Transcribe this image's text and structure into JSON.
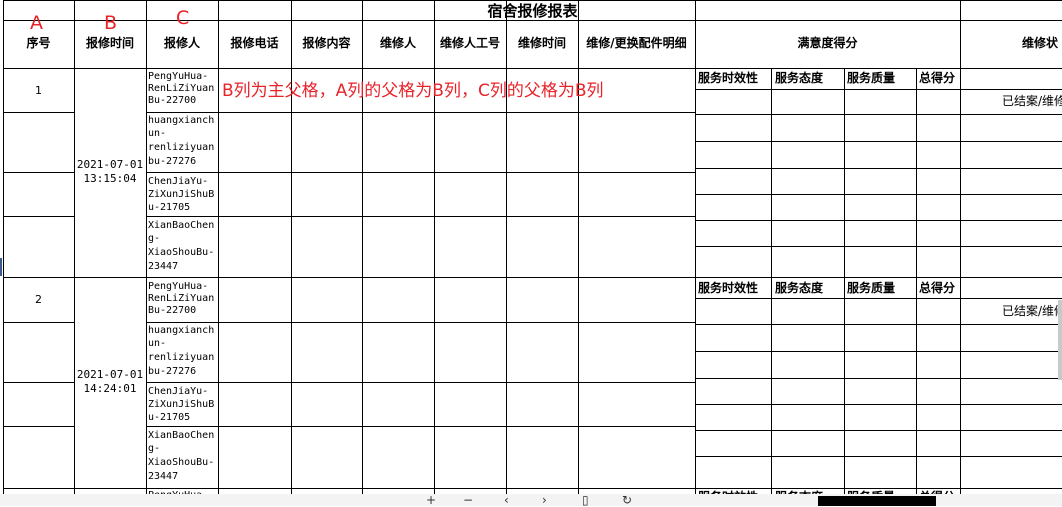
{
  "title": "宿舍报修报表",
  "column_letters": {
    "a": "A",
    "b": "B",
    "c": "C"
  },
  "headers": {
    "seq": "序号",
    "report_time": "报修时间",
    "reporter": "报修人",
    "phone": "报修电话",
    "content": "报修内容",
    "repairer": "维修人",
    "repairer_id": "维修人工号",
    "repair_time": "维修时间",
    "parts": "维修/更换配件明细",
    "satisfaction": "满意度得分",
    "status": "维修状"
  },
  "sub_headers": {
    "timeliness": "服务时效性",
    "attitude": "服务态度",
    "quality": "服务质量",
    "total": "总得分"
  },
  "annotation": "B列为主父格，A列的父格为B列，C列的父格为B列",
  "status_value": "已结案/维修",
  "groups": [
    {
      "seq": "1",
      "time_date": "2021-07-01",
      "time_clock": "13:15:04",
      "reporters": [
        {
          "l1": "PengYuHua-",
          "l2": "RenLiZiYuan",
          "l3": "Bu-22700",
          "l4": ""
        },
        {
          "l1": "huangxianch",
          "l2": "un-",
          "l3": "renliziyuan",
          "l4": "bu-27276"
        },
        {
          "l1": "ChenJiaYu-",
          "l2": "ZiXunJiShuB",
          "l3": "u-21705",
          "l4": ""
        },
        {
          "l1": "XianBaoChen",
          "l2": "g-",
          "l3": "XiaoShouBu-",
          "l4": "23447"
        }
      ]
    },
    {
      "seq": "2",
      "time_date": "2021-07-01",
      "time_clock": "14:24:01",
      "reporters": [
        {
          "l1": "PengYuHua-",
          "l2": "RenLiZiYuan",
          "l3": "Bu-22700",
          "l4": ""
        },
        {
          "l1": "huangxianch",
          "l2": "un-",
          "l3": "renliziyuan",
          "l4": "bu-27276"
        },
        {
          "l1": "ChenJiaYu-",
          "l2": "ZiXunJiShuB",
          "l3": "u-21705",
          "l4": ""
        },
        {
          "l1": "XianBaoChen",
          "l2": "g-",
          "l3": "XiaoShouBu-",
          "l4": "23447"
        }
      ]
    }
  ],
  "partial_row": {
    "reporter": "PengYuHua-",
    "timeliness": "服务时效性",
    "attitude": "服务态度",
    "quality": "服务质量",
    "total": "总得分"
  },
  "toolbar_icons": [
    "zoom-in-icon",
    "zoom-out-icon",
    "rotate-left-icon",
    "rotate-right-icon",
    "delete-icon",
    "refresh-icon"
  ]
}
